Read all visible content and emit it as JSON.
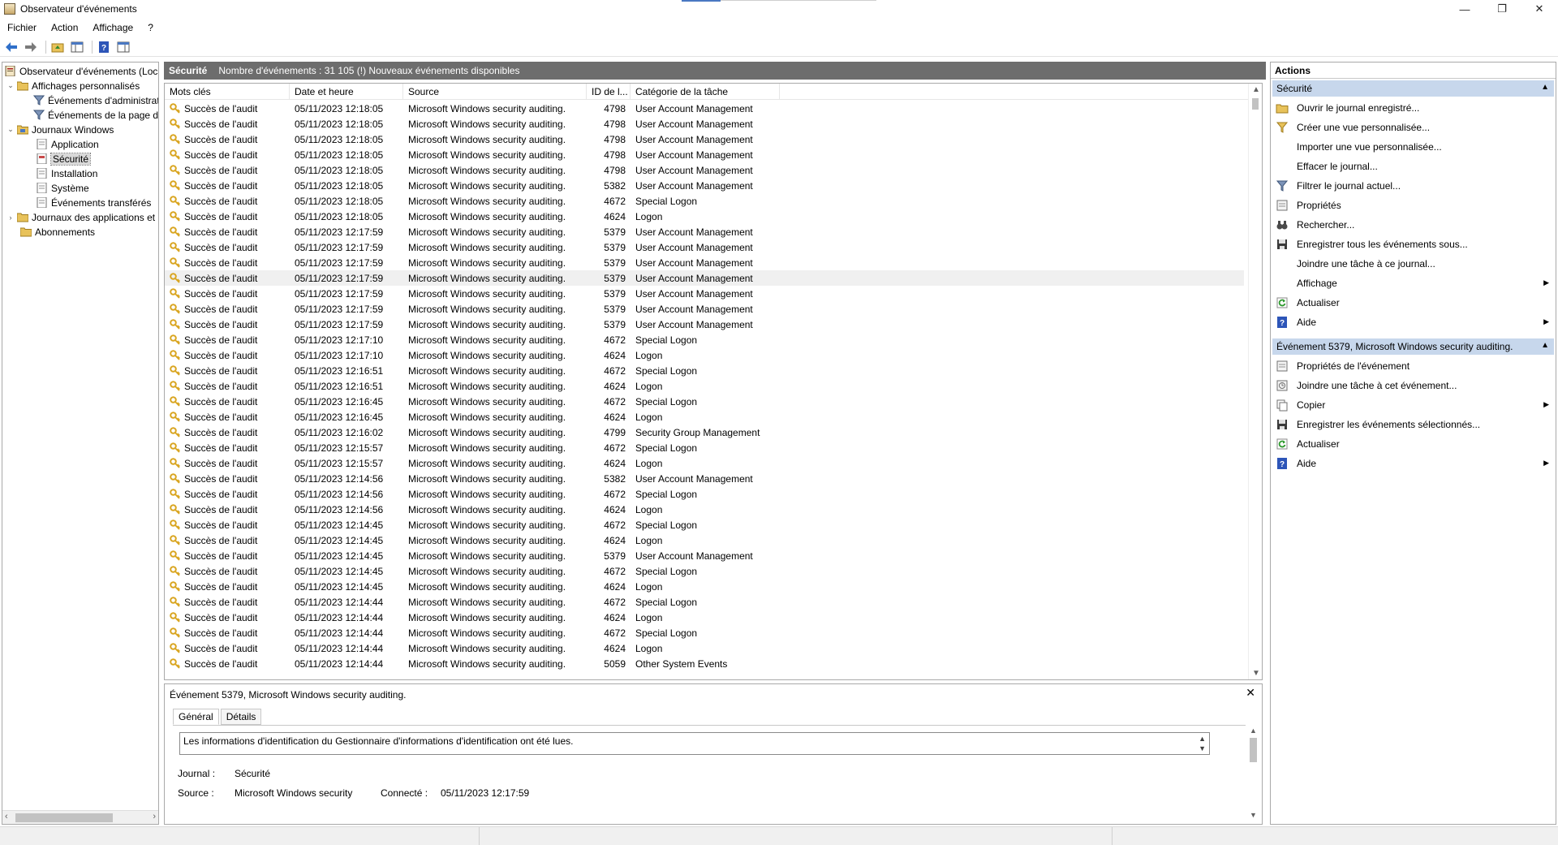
{
  "window": {
    "title": "Observateur d'événements",
    "minimize": "—",
    "restore": "❐",
    "close": "✕"
  },
  "menu": {
    "fichier": "Fichier",
    "action": "Action",
    "affichage": "Affichage",
    "help": "?"
  },
  "tree": {
    "root": "Observateur d'événements (Local)",
    "custom_views": "Affichages personnalisés",
    "admin_events": "Événements d'administration",
    "page_events": "Événements de la page d'accueil",
    "windows_logs": "Journaux Windows",
    "application": "Application",
    "security": "Sécurité",
    "installation": "Installation",
    "system": "Système",
    "forwarded": "Événements transférés",
    "app_logs": "Journaux des applications et",
    "subscriptions": "Abonnements"
  },
  "center": {
    "log_name": "Sécurité",
    "event_count": "Nombre d'événements : 31 105 (!) Nouveaux événements disponibles"
  },
  "columns": {
    "keywords": "Mots clés",
    "datetime": "Date et heure",
    "source": "Source",
    "id": "ID de l...",
    "category": "Catégorie de la tâche"
  },
  "events": [
    {
      "kw": "Succès de l'audit",
      "dt": "05/11/2023 12:18:05",
      "src": "Microsoft Windows security auditing.",
      "id": "4798",
      "cat": "User Account Management"
    },
    {
      "kw": "Succès de l'audit",
      "dt": "05/11/2023 12:18:05",
      "src": "Microsoft Windows security auditing.",
      "id": "4798",
      "cat": "User Account Management"
    },
    {
      "kw": "Succès de l'audit",
      "dt": "05/11/2023 12:18:05",
      "src": "Microsoft Windows security auditing.",
      "id": "4798",
      "cat": "User Account Management"
    },
    {
      "kw": "Succès de l'audit",
      "dt": "05/11/2023 12:18:05",
      "src": "Microsoft Windows security auditing.",
      "id": "4798",
      "cat": "User Account Management"
    },
    {
      "kw": "Succès de l'audit",
      "dt": "05/11/2023 12:18:05",
      "src": "Microsoft Windows security auditing.",
      "id": "4798",
      "cat": "User Account Management"
    },
    {
      "kw": "Succès de l'audit",
      "dt": "05/11/2023 12:18:05",
      "src": "Microsoft Windows security auditing.",
      "id": "5382",
      "cat": "User Account Management"
    },
    {
      "kw": "Succès de l'audit",
      "dt": "05/11/2023 12:18:05",
      "src": "Microsoft Windows security auditing.",
      "id": "4672",
      "cat": "Special Logon"
    },
    {
      "kw": "Succès de l'audit",
      "dt": "05/11/2023 12:18:05",
      "src": "Microsoft Windows security auditing.",
      "id": "4624",
      "cat": "Logon"
    },
    {
      "kw": "Succès de l'audit",
      "dt": "05/11/2023 12:17:59",
      "src": "Microsoft Windows security auditing.",
      "id": "5379",
      "cat": "User Account Management"
    },
    {
      "kw": "Succès de l'audit",
      "dt": "05/11/2023 12:17:59",
      "src": "Microsoft Windows security auditing.",
      "id": "5379",
      "cat": "User Account Management"
    },
    {
      "kw": "Succès de l'audit",
      "dt": "05/11/2023 12:17:59",
      "src": "Microsoft Windows security auditing.",
      "id": "5379",
      "cat": "User Account Management"
    },
    {
      "kw": "Succès de l'audit",
      "dt": "05/11/2023 12:17:59",
      "src": "Microsoft Windows security auditing.",
      "id": "5379",
      "cat": "User Account Management",
      "selected": true
    },
    {
      "kw": "Succès de l'audit",
      "dt": "05/11/2023 12:17:59",
      "src": "Microsoft Windows security auditing.",
      "id": "5379",
      "cat": "User Account Management"
    },
    {
      "kw": "Succès de l'audit",
      "dt": "05/11/2023 12:17:59",
      "src": "Microsoft Windows security auditing.",
      "id": "5379",
      "cat": "User Account Management"
    },
    {
      "kw": "Succès de l'audit",
      "dt": "05/11/2023 12:17:59",
      "src": "Microsoft Windows security auditing.",
      "id": "5379",
      "cat": "User Account Management"
    },
    {
      "kw": "Succès de l'audit",
      "dt": "05/11/2023 12:17:10",
      "src": "Microsoft Windows security auditing.",
      "id": "4672",
      "cat": "Special Logon"
    },
    {
      "kw": "Succès de l'audit",
      "dt": "05/11/2023 12:17:10",
      "src": "Microsoft Windows security auditing.",
      "id": "4624",
      "cat": "Logon"
    },
    {
      "kw": "Succès de l'audit",
      "dt": "05/11/2023 12:16:51",
      "src": "Microsoft Windows security auditing.",
      "id": "4672",
      "cat": "Special Logon"
    },
    {
      "kw": "Succès de l'audit",
      "dt": "05/11/2023 12:16:51",
      "src": "Microsoft Windows security auditing.",
      "id": "4624",
      "cat": "Logon"
    },
    {
      "kw": "Succès de l'audit",
      "dt": "05/11/2023 12:16:45",
      "src": "Microsoft Windows security auditing.",
      "id": "4672",
      "cat": "Special Logon"
    },
    {
      "kw": "Succès de l'audit",
      "dt": "05/11/2023 12:16:45",
      "src": "Microsoft Windows security auditing.",
      "id": "4624",
      "cat": "Logon"
    },
    {
      "kw": "Succès de l'audit",
      "dt": "05/11/2023 12:16:02",
      "src": "Microsoft Windows security auditing.",
      "id": "4799",
      "cat": "Security Group Management"
    },
    {
      "kw": "Succès de l'audit",
      "dt": "05/11/2023 12:15:57",
      "src": "Microsoft Windows security auditing.",
      "id": "4672",
      "cat": "Special Logon"
    },
    {
      "kw": "Succès de l'audit",
      "dt": "05/11/2023 12:15:57",
      "src": "Microsoft Windows security auditing.",
      "id": "4624",
      "cat": "Logon"
    },
    {
      "kw": "Succès de l'audit",
      "dt": "05/11/2023 12:14:56",
      "src": "Microsoft Windows security auditing.",
      "id": "5382",
      "cat": "User Account Management"
    },
    {
      "kw": "Succès de l'audit",
      "dt": "05/11/2023 12:14:56",
      "src": "Microsoft Windows security auditing.",
      "id": "4672",
      "cat": "Special Logon"
    },
    {
      "kw": "Succès de l'audit",
      "dt": "05/11/2023 12:14:56",
      "src": "Microsoft Windows security auditing.",
      "id": "4624",
      "cat": "Logon"
    },
    {
      "kw": "Succès de l'audit",
      "dt": "05/11/2023 12:14:45",
      "src": "Microsoft Windows security auditing.",
      "id": "4672",
      "cat": "Special Logon"
    },
    {
      "kw": "Succès de l'audit",
      "dt": "05/11/2023 12:14:45",
      "src": "Microsoft Windows security auditing.",
      "id": "4624",
      "cat": "Logon"
    },
    {
      "kw": "Succès de l'audit",
      "dt": "05/11/2023 12:14:45",
      "src": "Microsoft Windows security auditing.",
      "id": "5379",
      "cat": "User Account Management"
    },
    {
      "kw": "Succès de l'audit",
      "dt": "05/11/2023 12:14:45",
      "src": "Microsoft Windows security auditing.",
      "id": "4672",
      "cat": "Special Logon"
    },
    {
      "kw": "Succès de l'audit",
      "dt": "05/11/2023 12:14:45",
      "src": "Microsoft Windows security auditing.",
      "id": "4624",
      "cat": "Logon"
    },
    {
      "kw": "Succès de l'audit",
      "dt": "05/11/2023 12:14:44",
      "src": "Microsoft Windows security auditing.",
      "id": "4672",
      "cat": "Special Logon"
    },
    {
      "kw": "Succès de l'audit",
      "dt": "05/11/2023 12:14:44",
      "src": "Microsoft Windows security auditing.",
      "id": "4624",
      "cat": "Logon"
    },
    {
      "kw": "Succès de l'audit",
      "dt": "05/11/2023 12:14:44",
      "src": "Microsoft Windows security auditing.",
      "id": "4672",
      "cat": "Special Logon"
    },
    {
      "kw": "Succès de l'audit",
      "dt": "05/11/2023 12:14:44",
      "src": "Microsoft Windows security auditing.",
      "id": "4624",
      "cat": "Logon"
    },
    {
      "kw": "Succès de l'audit",
      "dt": "05/11/2023 12:14:44",
      "src": "Microsoft Windows security auditing.",
      "id": "5059",
      "cat": "Other System Events"
    }
  ],
  "detail": {
    "title": "Événement 5379, Microsoft Windows security auditing.",
    "tab_general": "Général",
    "tab_details": "Détails",
    "description": "Les informations d'identification du Gestionnaire d'informations d'identification ont été lues.",
    "journal_label": "Journal :",
    "journal_value": "Sécurité",
    "source_label": "Source :",
    "source_value": "Microsoft Windows security",
    "connected_label": "Connecté :",
    "connected_value": "05/11/2023 12:17:59"
  },
  "actions": {
    "title": "Actions",
    "section1": "Sécurité",
    "items1": [
      {
        "label": "Ouvrir le journal enregistré...",
        "icon": "folder-open-icon",
        "sub": false
      },
      {
        "label": "Créer une vue personnalisée...",
        "icon": "filter-create-icon",
        "sub": false
      },
      {
        "label": "Importer une vue personnalisée...",
        "icon": "",
        "sub": false
      },
      {
        "label": "Effacer le journal...",
        "icon": "",
        "sub": false
      },
      {
        "label": "Filtrer le journal actuel...",
        "icon": "filter-icon",
        "sub": false
      },
      {
        "label": "Propriétés",
        "icon": "properties-icon",
        "sub": false
      },
      {
        "label": "Rechercher...",
        "icon": "binoculars-icon",
        "sub": false
      },
      {
        "label": "Enregistrer tous les événements sous...",
        "icon": "save-icon",
        "sub": false
      },
      {
        "label": "Joindre une tâche à ce journal...",
        "icon": "",
        "sub": false
      },
      {
        "label": "Affichage",
        "icon": "",
        "sub": true
      },
      {
        "label": "Actualiser",
        "icon": "refresh-icon",
        "sub": false
      },
      {
        "label": "Aide",
        "icon": "help-icon",
        "sub": true
      }
    ],
    "section2": "Événement 5379, Microsoft Windows security auditing.",
    "items2": [
      {
        "label": "Propriétés de l'événement",
        "icon": "properties-icon",
        "sub": false
      },
      {
        "label": "Joindre une tâche à cet événement...",
        "icon": "task-icon",
        "sub": false
      },
      {
        "label": "Copier",
        "icon": "copy-icon",
        "sub": true
      },
      {
        "label": "Enregistrer les événements sélectionnés...",
        "icon": "save-icon",
        "sub": false
      },
      {
        "label": "Actualiser",
        "icon": "refresh-icon",
        "sub": false
      },
      {
        "label": "Aide",
        "icon": "help-icon",
        "sub": true
      }
    ]
  },
  "colors": {
    "header_bg": "#6d6d6d",
    "section_bg": "#c7d7ec",
    "key_icon": "#d9a520"
  }
}
